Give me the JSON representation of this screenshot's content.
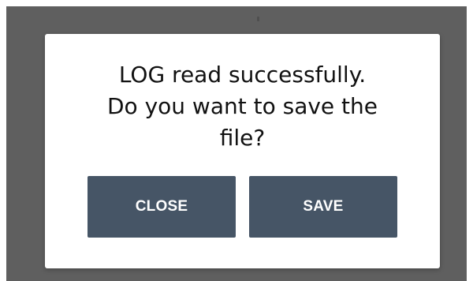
{
  "dialog": {
    "message": "LOG read successfully.\nDo you want to save the\nfile?",
    "close_label": "CLOSE",
    "save_label": "SAVE"
  },
  "colors": {
    "backdrop": "#5f5f5f",
    "dialog_background": "#ffffff",
    "button_background": "#465566",
    "button_text": "#ffffff",
    "message_text": "#111111"
  }
}
